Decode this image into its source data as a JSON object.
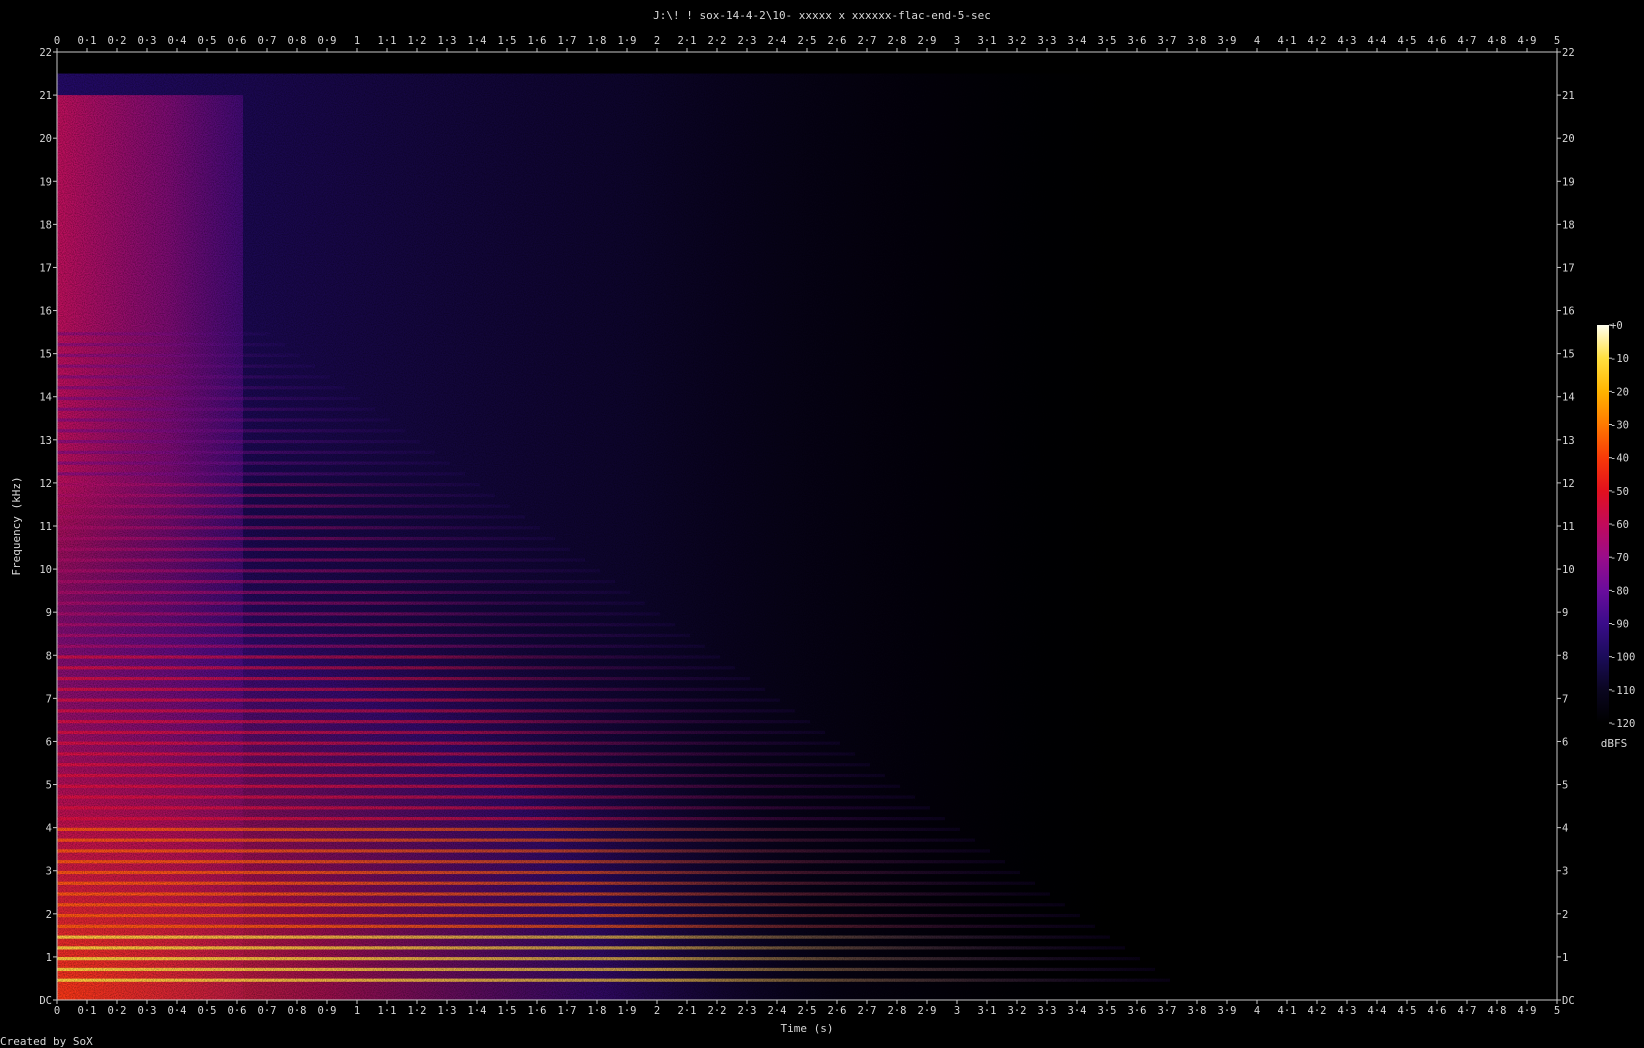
{
  "title": "J:\\! ! sox-14-4-2\\10- xxxxx x xxxxxx-flac-end-5-sec",
  "credit": "Created by SoX",
  "chart_data": {
    "type": "heatmap",
    "xlabel": "Time (s)",
    "ylabel": "Frequency (kHz)",
    "xlim": [
      0,
      5
    ],
    "ylim": [
      0,
      22
    ],
    "x_ticks": [
      "0",
      "0·1",
      "0·2",
      "0·3",
      "0·4",
      "0·5",
      "0·6",
      "0·7",
      "0·8",
      "0·9",
      "1",
      "1·1",
      "1·2",
      "1·3",
      "1·4",
      "1·5",
      "1·6",
      "1·7",
      "1·8",
      "1·9",
      "2",
      "2·1",
      "2·2",
      "2·3",
      "2·4",
      "2·5",
      "2·6",
      "2·7",
      "2·8",
      "2·9",
      "3",
      "3·1",
      "3·2",
      "3·3",
      "3·4",
      "3·5",
      "3·6",
      "3·7",
      "3·8",
      "3·9",
      "4",
      "4·1",
      "4·2",
      "4·3",
      "4·4",
      "4·5",
      "4·6",
      "4·7",
      "4·8",
      "4·9",
      "5"
    ],
    "y_ticks": [
      "DC",
      "1",
      "2",
      "3",
      "4",
      "5",
      "6",
      "7",
      "8",
      "9",
      "10",
      "11",
      "12",
      "13",
      "14",
      "15",
      "16",
      "17",
      "18",
      "19",
      "20",
      "21",
      "22"
    ],
    "colorbar": {
      "label": "dBFS",
      "ticks": [
        "+0",
        "-10",
        "-20",
        "-30",
        "-40",
        "-50",
        "-60",
        "-70",
        "-80",
        "-90",
        "-100",
        "-110",
        "-120"
      ],
      "range_db": [
        -120,
        0
      ],
      "colors": [
        "#000000",
        "#0a0620",
        "#1b0c5a",
        "#3a0c8a",
        "#6a0c9c",
        "#9a0c8a",
        "#c20a5a",
        "#e2101e",
        "#f83a08",
        "#ff7a00",
        "#ffb400",
        "#ffe040",
        "#fffff0"
      ]
    },
    "audio_end_s": 3.82,
    "harmonics_khz": [
      0.45,
      0.7,
      0.95,
      1.2,
      1.45,
      1.7,
      1.95,
      2.2,
      2.45,
      2.7,
      2.95,
      3.2,
      3.45,
      3.7,
      3.95,
      4.2,
      4.45,
      4.7,
      4.95,
      5.2,
      5.45,
      5.7,
      5.95,
      6.2,
      6.45,
      6.7,
      6.95,
      7.2,
      7.45,
      7.7,
      7.95,
      8.2,
      8.45,
      8.7,
      8.95,
      9.2,
      9.45,
      9.7,
      9.95,
      10.2,
      10.45,
      10.7,
      10.95,
      11.2,
      11.45,
      11.7,
      11.95,
      12.2,
      12.45,
      12.7,
      12.95,
      13.2,
      13.45,
      13.7,
      13.95,
      14.2,
      14.45,
      14.7,
      14.95,
      15.2,
      15.45
    ]
  }
}
